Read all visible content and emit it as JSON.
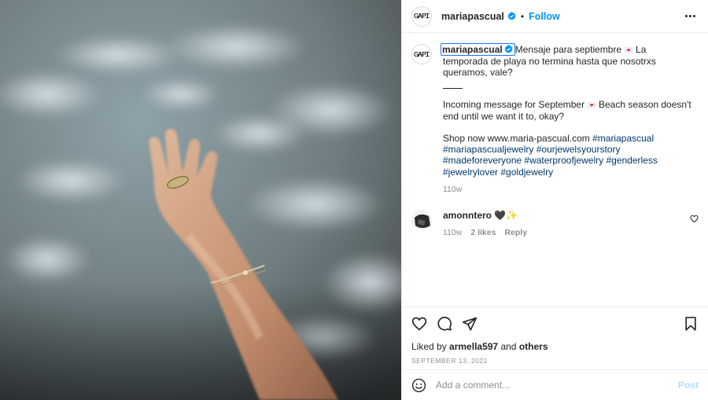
{
  "photo": {
    "alt_icon": "beach-hand-photo"
  },
  "header": {
    "avatar_text": "ᏀᎪᏢᏆ",
    "username": "mariapascual",
    "separator": "•",
    "follow_label": "Follow",
    "more_icon": "more-horizontal-icon"
  },
  "caption": {
    "username": "mariapascual",
    "text_es": "Mensaje para septiembre",
    "text_es_emoji": "💌",
    "text_es_cont": " La temporada de playa no termina hasta que nosotrxs queramos, vale?",
    "text_en": "Incoming message for September",
    "text_en_emoji": "💌",
    "text_en_cont": " Beach season doesn't end until we want it to, okay?",
    "shop_text": "Shop now www.maria-pascual.com",
    "hashtags": [
      "#mariapascual",
      "#mariapascualjewelry",
      "#ourjewelsyourstory",
      "#madeforeveryone",
      "#waterproofjewelry",
      "#genderless",
      "#jewelrylover",
      "#goldjewelry"
    ],
    "time": "110w"
  },
  "comment": {
    "username": "amonntero",
    "text": "🖤✨",
    "time": "110w",
    "likes": "2 likes",
    "reply_label": "Reply"
  },
  "actions": {
    "liked_by_prefix": "Liked by",
    "liked_by_user": "armella597",
    "liked_by_suffix": "and",
    "liked_by_others": "others",
    "date": "SEPTEMBER 13, 2021"
  },
  "add_comment": {
    "placeholder": "Add a comment...",
    "post_label": "Post"
  },
  "colors": {
    "accent": "#0095f6",
    "hashtag": "#00376b",
    "muted": "#8e8e8e",
    "post_disabled": "#b2dffc"
  }
}
